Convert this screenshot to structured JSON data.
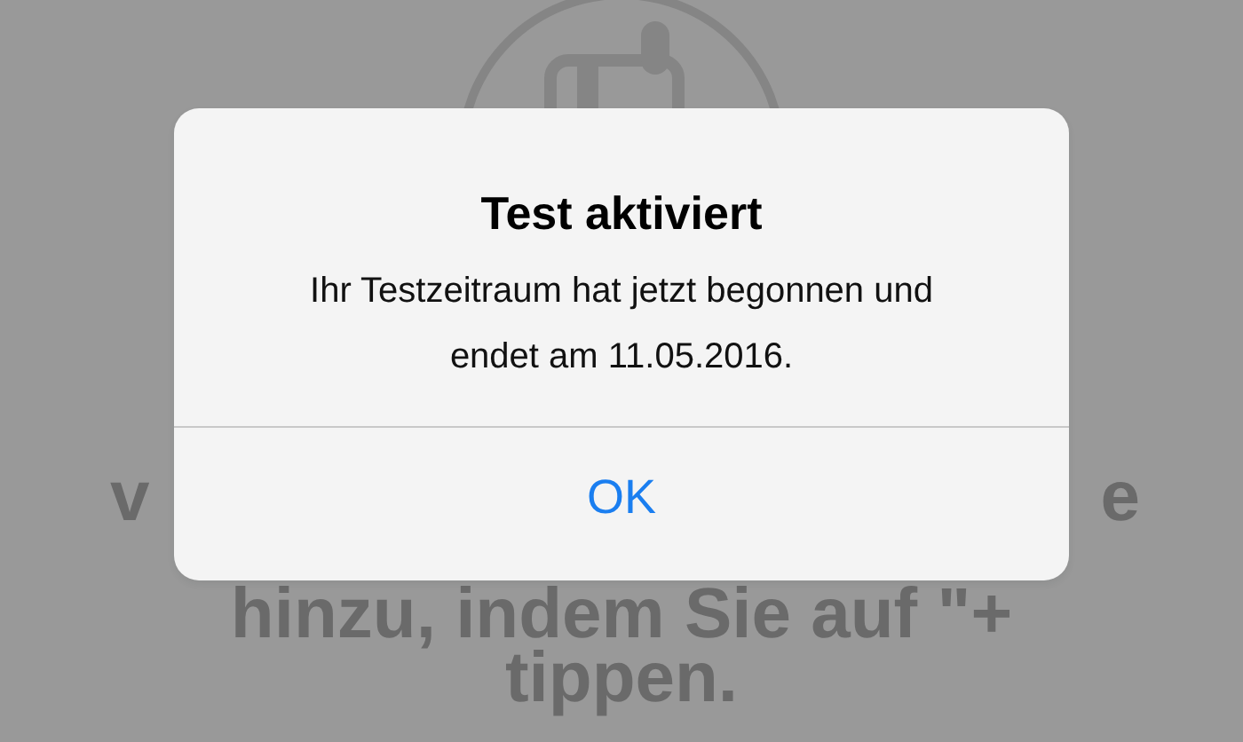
{
  "background": {
    "line_1_left": "v",
    "line_1_right": "e",
    "line_2": "hinzu, indem Sie auf \"+",
    "line_3": "tippen."
  },
  "alert": {
    "title": "Test aktiviert",
    "message": "Ihr Testzeitraum hat jetzt begonnen und endet am 11.05.2016.",
    "buttons": [
      {
        "label": "OK"
      }
    ]
  }
}
